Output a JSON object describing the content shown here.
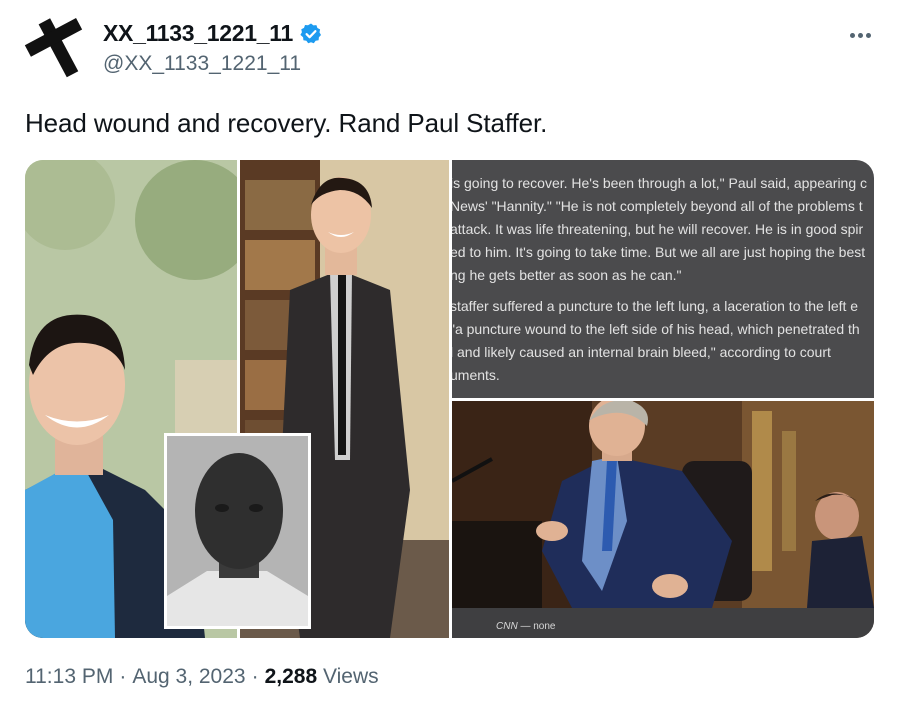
{
  "author": {
    "display_name": "XX_1133_1221_11",
    "handle": "@XX_1133_1221_11",
    "verified": true,
    "avatar_icon": "black-cross-icon",
    "verified_color": "#1d9bf0"
  },
  "more_icon": "more-dots-icon",
  "tweet": {
    "text": "Head wound and recovery. Rand Paul Staffer."
  },
  "media": {
    "article_paragraph_1": [
      "is going to recover. He's been through a lot,\" Paul said, appearing c",
      "News' \"Hannity.\" \"He is not completely beyond all of the problems t",
      "attack. It was life threatening, but he will recover. He is in good spir",
      "ed to him. It's going to take time. But we all are just hoping the best",
      "ng he gets better as soon as he can.\""
    ],
    "article_paragraph_2": [
      "staffer suffered a puncture to the left lung, a laceration to the left e",
      "\"a puncture wound to the left side of his head, which penetrated th",
      "l and likely caused an internal brain bleed,\" according to court",
      "uments."
    ],
    "photo_caption_source": "CNN",
    "photo_caption_dash": "—",
    "photo_caption_credit": "none"
  },
  "meta": {
    "time": "11:13 PM",
    "dot": "·",
    "date": "Aug 3, 2023",
    "views_count": "2,288",
    "views_label": "Views"
  }
}
